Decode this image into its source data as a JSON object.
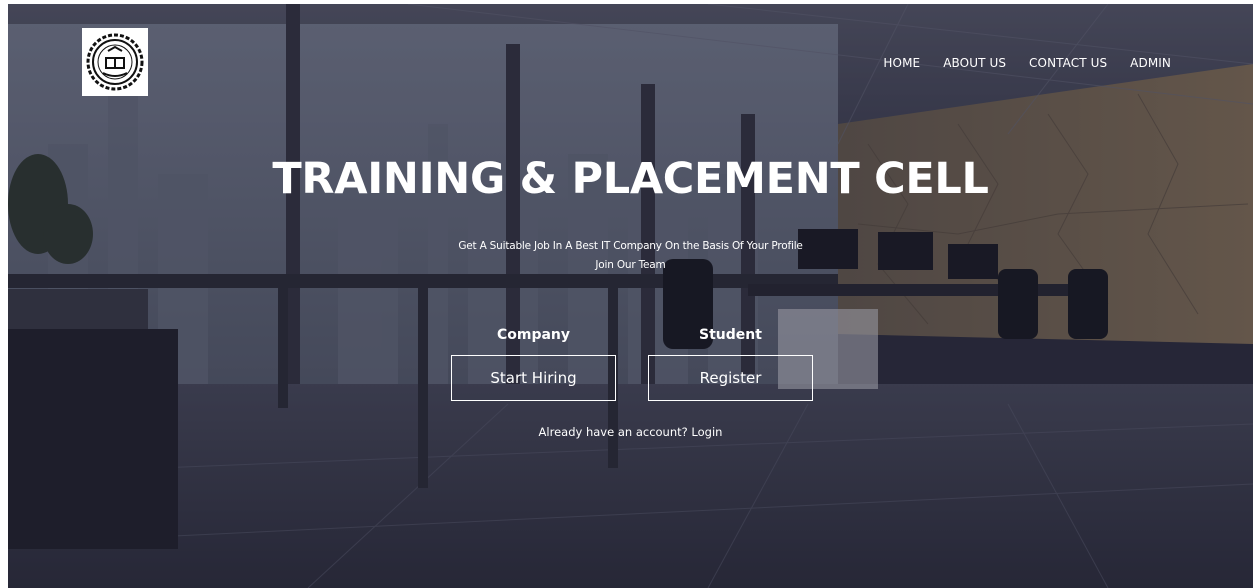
{
  "logo": {
    "icon": "college-emblem-icon"
  },
  "nav": {
    "home": "HOME",
    "about": "ABOUT US",
    "contact": "CONTACT US",
    "admin": "ADMIN"
  },
  "hero": {
    "title": "TRAINING & PLACEMENT CELL",
    "subtitle_line1": "Get A Suitable Job In A Best IT Company On the Basis Of Your Profile",
    "subtitle_line2": "Join Our Team"
  },
  "company": {
    "label": "Company",
    "button": "Start Hiring"
  },
  "student": {
    "label": "Student",
    "button": "Register"
  },
  "login": {
    "prompt": "Already have an account?",
    "link": "Login"
  }
}
